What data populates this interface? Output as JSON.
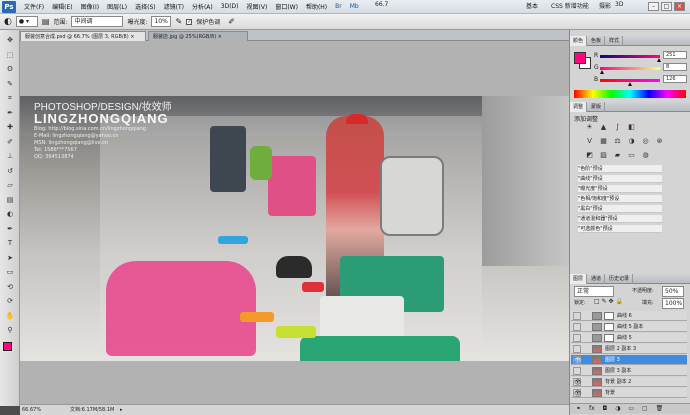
{
  "menubar": {
    "app_icon": "Ps",
    "items": [
      "文件(F)",
      "编辑(E)",
      "图像(I)",
      "图层(L)",
      "选择(S)",
      "滤镜(T)",
      "分析(A)",
      "3D(D)",
      "视图(V)",
      "窗口(W)",
      "帮助(H)"
    ],
    "zoom_value": "66.7",
    "workspace_basic": "基本",
    "workspace_cs5": "CSS 新增功能",
    "workspace_extra": "摄影",
    "workspace_3d": "3D",
    "minimize": "–",
    "restore": "□",
    "close": "×"
  },
  "options_bar": {
    "range_label": "范围:",
    "range_value": "中间调",
    "exposure_label": "曝光度:",
    "exposure_value": "10%",
    "protect_label": "保护色调"
  },
  "doc_tabs": [
    {
      "label": "服装创意合成.psd @ 66.7% (图层 3, RGB/8) ×",
      "active": true
    },
    {
      "label": "服装店.jpg @ 25%(RGB/8) ×",
      "active": false
    }
  ],
  "watermark": {
    "line1": "PHOTOSHOP/DESIGN/妆效师",
    "line2": "LINGZHONGQIANG",
    "line3": "Blog: http://blog.sina.com.cn/lingzhongqiang",
    "line4": "E-Mail: lingzhongqiang@yahoo.cn",
    "line5": "MSN: lingzhongqiang@live.cn",
    "line6": "Tel: 1586***7567",
    "line7": "QQ: 364513874"
  },
  "status_bar": {
    "zoom": "66.67%",
    "doc_size": "文档:6.17M/58.1M"
  },
  "color_panel": {
    "tabs": [
      "颜色",
      "色板",
      "样式"
    ],
    "r_label": "R",
    "r_value": "251",
    "g_label": "G",
    "g_value": "8",
    "b_label": "B",
    "b_value": "126",
    "r_fraction": 0.984,
    "g_fraction": 0.031,
    "b_fraction": 0.494,
    "foreground_color": "#fb087e",
    "background_color": "#ffffff"
  },
  "adjust_panel": {
    "tabs": [
      "调整",
      "蒙版"
    ],
    "title": "添加调整",
    "presets": [
      "\"色阶\"预设",
      "\"曲线\"预设",
      "\"曝光度\"预设",
      "\"色相/饱和度\"预设",
      "\"黑白\"预设",
      "\"通道混和器\"预设",
      "\"可选颜色\"预设"
    ]
  },
  "layers_panel": {
    "tabs": [
      "图层",
      "通道",
      "历史记录"
    ],
    "blend_mode": "正常",
    "opacity_label": "不透明度:",
    "opacity_value": "50%",
    "lock_label": "锁定:",
    "fill_label": "填充:",
    "fill_value": "100%",
    "layers": [
      {
        "name": "曲线 6",
        "visible": false,
        "selected": false,
        "mask": true
      },
      {
        "name": "曲线 5 副本",
        "visible": false,
        "selected": false,
        "mask": true
      },
      {
        "name": "曲线 5",
        "visible": false,
        "selected": false,
        "mask": true
      },
      {
        "name": "图层 2 副本 3",
        "visible": false,
        "selected": false,
        "mask": false
      },
      {
        "name": "图层 3",
        "visible": true,
        "selected": true,
        "mask": false
      },
      {
        "name": "图层 3 副本",
        "visible": false,
        "selected": false,
        "mask": false
      },
      {
        "name": "背景 副本 2",
        "visible": true,
        "selected": false,
        "mask": false
      },
      {
        "name": "背景",
        "visible": true,
        "selected": false,
        "mask": false
      }
    ]
  },
  "tools": [
    "move-icon",
    "marquee-icon",
    "lasso-icon",
    "quick-select-icon",
    "crop-icon",
    "eyedropper-icon",
    "healing-icon",
    "brush-icon",
    "clone-stamp-icon",
    "history-brush-icon",
    "eraser-icon",
    "gradient-icon",
    "dodge-icon",
    "pen-icon",
    "text-icon",
    "path-select-icon",
    "shape-icon",
    "3d-rotate-icon",
    "3d-orbit-icon",
    "hand-icon",
    "zoom-icon"
  ]
}
